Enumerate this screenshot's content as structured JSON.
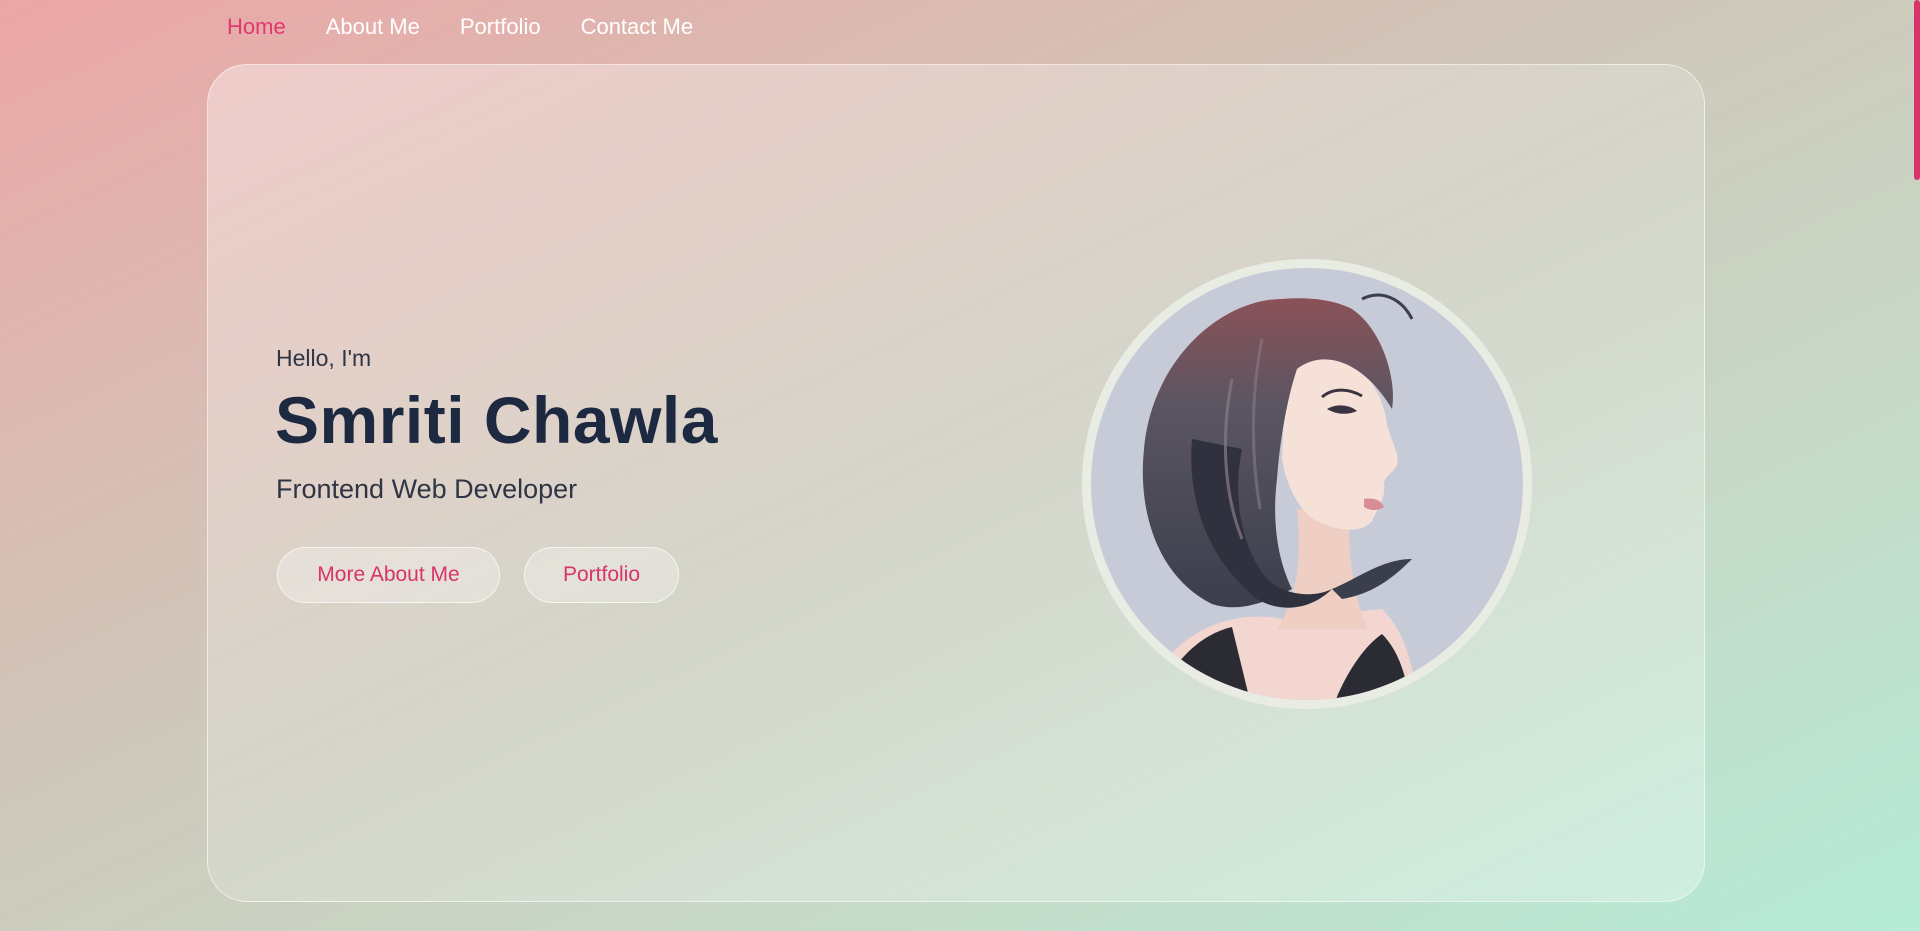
{
  "nav": {
    "items": [
      {
        "label": "Home",
        "active": true
      },
      {
        "label": "About Me",
        "active": false
      },
      {
        "label": "Portfolio",
        "active": false
      },
      {
        "label": "Contact Me",
        "active": false
      }
    ]
  },
  "hero": {
    "greeting": "Hello, I'm",
    "name": "Smriti Chawla",
    "role": "Frontend Web Developer",
    "buttons": {
      "more_about": "More About Me",
      "portfolio": "Portfolio"
    }
  },
  "avatar": {
    "icon": "profile-illustration-icon"
  },
  "colors": {
    "accent": "#e0396f",
    "heading": "#1c2940",
    "text": "#2f3544",
    "avatar_ring": "#e8ece3",
    "avatar_bg": "#c7cbd8"
  }
}
